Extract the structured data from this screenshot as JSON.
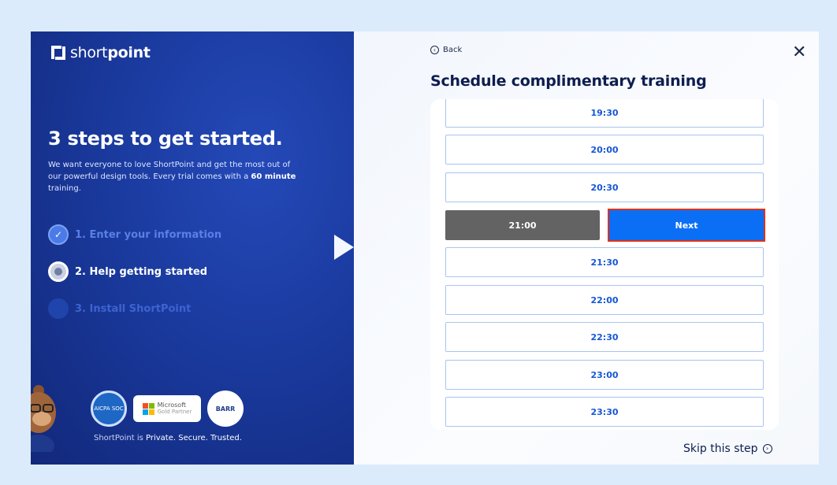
{
  "brand": {
    "prefix": "short",
    "bold": "point"
  },
  "left": {
    "headline": "3 steps to get started.",
    "intro_text": "We want everyone to love ShortPoint and get the most out of our powerful design tools. Every trial comes with a ",
    "intro_bold": "60 minute",
    "intro_end": " training.",
    "steps": [
      {
        "label": "1. Enter your information",
        "state": "done"
      },
      {
        "label": "2. Help getting started",
        "state": "current"
      },
      {
        "label": "3. Install ShortPoint",
        "state": "upcoming"
      }
    ],
    "badges": {
      "aicpa": "AICPA SOC",
      "ms_line1": "Microsoft",
      "ms_line2": "Gold Partner",
      "barr": "BARR"
    },
    "trust_prefix": "ShortPoint is ",
    "trust_bold": "Private. Secure. Trusted."
  },
  "right": {
    "back_label": "Back",
    "close_glyph": "✕",
    "title": "Schedule complimentary training",
    "slots": [
      "19:30",
      "20:00",
      "20:30",
      "21:00",
      "21:30",
      "22:00",
      "22:30",
      "23:00",
      "23:30"
    ],
    "selected_slot": "21:00",
    "next_label": "Next",
    "skip_label": "Skip this step"
  },
  "colors": {
    "accent": "#0a6ff5",
    "selected_slot": "#636363",
    "highlight_border": "#e2301b",
    "panel_blue": "#1a3a9e"
  }
}
